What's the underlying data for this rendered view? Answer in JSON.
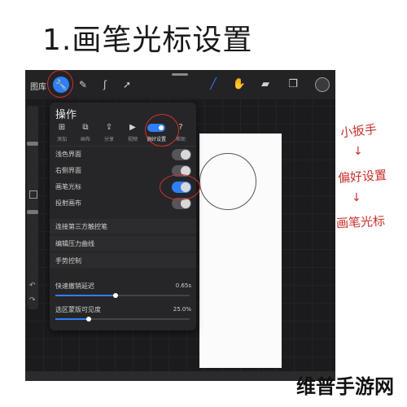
{
  "heading": "1.画笔光标设置",
  "toolbar": {
    "gallery_label": "图库",
    "left_icons": [
      "wrench-icon",
      "magic-wand-icon",
      "adjust-s-icon",
      "selection-arrow-icon"
    ],
    "right_icons": [
      "brush-icon",
      "smudge-icon",
      "eraser-icon",
      "layers-icon",
      "color-dot-icon"
    ]
  },
  "panel": {
    "title": "操作",
    "categories": [
      {
        "label": "添加",
        "icon": "add-icon"
      },
      {
        "label": "画布",
        "icon": "canvas-icon"
      },
      {
        "label": "分享",
        "icon": "share-icon"
      },
      {
        "label": "视频",
        "icon": "video-icon"
      },
      {
        "label": "偏好设置",
        "icon": "toggle-icon"
      },
      {
        "label": "帮助",
        "icon": "help-icon"
      }
    ],
    "toggles": [
      {
        "label": "浅色界面",
        "on": false
      },
      {
        "label": "右侧界面",
        "on": false
      },
      {
        "label": "画笔光标",
        "on": true
      },
      {
        "label": "投射画布",
        "on": false
      }
    ],
    "links": [
      "连接第三方触控笔",
      "编辑压力曲线",
      "手势控制"
    ],
    "sliders": [
      {
        "label": "快速撤销延迟",
        "value": "0.65s",
        "fraction": 0.45
      },
      {
        "label": "选区蒙版可见度",
        "value": "25.0%",
        "fraction": 0.25
      }
    ]
  },
  "annotations": {
    "note1": "小扳手",
    "note2": "偏好设置",
    "note3": "画笔光标",
    "arrow": "↓"
  },
  "colors": {
    "accent": "#2f7ef5",
    "annotation": "#c8302c"
  },
  "watermark": "维普手游网"
}
